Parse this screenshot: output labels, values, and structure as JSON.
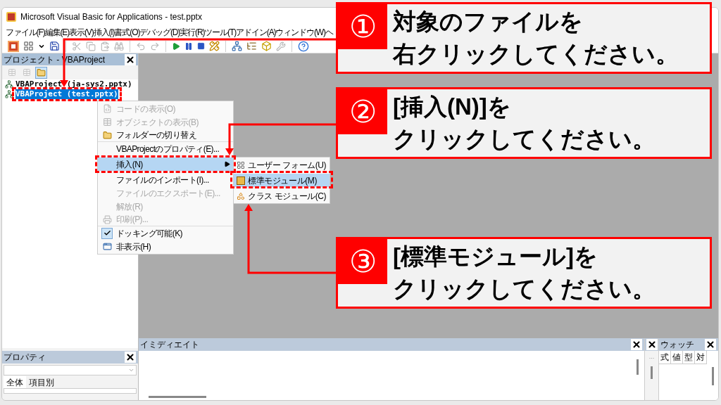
{
  "window": {
    "title": "Microsoft Visual Basic for Applications - test.pptx"
  },
  "menu_bar": [
    "ファイル(F)",
    "編集(E)",
    "表示(V)",
    "挿入(I)",
    "書式(O)",
    "デバッグ(D)",
    "実行(R)",
    "ツール(T)",
    "アドイン(A)",
    "ウィンドウ(W)",
    "ヘ"
  ],
  "toolbar": [
    {
      "kind": "app",
      "disabled": false
    },
    {
      "kind": "form",
      "disabled": false
    },
    {
      "kind": "caret",
      "disabled": false
    },
    {
      "kind": "save",
      "disabled": false
    },
    {
      "kind": "sep"
    },
    {
      "kind": "cut",
      "disabled": true
    },
    {
      "kind": "copy",
      "disabled": true
    },
    {
      "kind": "paste",
      "disabled": true
    },
    {
      "kind": "find",
      "disabled": true
    },
    {
      "kind": "sep"
    },
    {
      "kind": "undo",
      "disabled": true
    },
    {
      "kind": "redo",
      "disabled": true
    },
    {
      "kind": "sep"
    },
    {
      "kind": "run",
      "disabled": false
    },
    {
      "kind": "pause",
      "disabled": false
    },
    {
      "kind": "stop",
      "disabled": false
    },
    {
      "kind": "design",
      "disabled": false
    },
    {
      "kind": "sep"
    },
    {
      "kind": "explorer",
      "disabled": false
    },
    {
      "kind": "properties",
      "disabled": false
    },
    {
      "kind": "browser",
      "disabled": false
    },
    {
      "kind": "toolbox",
      "disabled": true
    },
    {
      "kind": "sep"
    },
    {
      "kind": "help",
      "disabled": false
    }
  ],
  "project_panel": {
    "title": "プロジェクト - VBAProject",
    "buttons": [
      {
        "kind": "code",
        "selected": false
      },
      {
        "kind": "object",
        "selected": false
      },
      {
        "kind": "folder",
        "selected": true
      }
    ],
    "tree": [
      {
        "label": "VBAProject (ja-sys2.pptx)",
        "selected": false
      },
      {
        "label": "VBAProject (test.pptx)",
        "selected": true
      }
    ]
  },
  "context_menu": [
    {
      "label": "コードの表示(O)",
      "kind": "code",
      "disabled": true,
      "selected": false,
      "checked": false,
      "separator_after": false
    },
    {
      "label": "オブジェクトの表示(B)",
      "kind": "object",
      "disabled": true,
      "selected": false,
      "checked": false,
      "separator_after": false
    },
    {
      "label": "フォルダーの切り替え",
      "kind": "folder",
      "disabled": false,
      "selected": false,
      "checked": false,
      "separator_after": true
    },
    {
      "label": "VBAProjectのプロパティ(E)...",
      "kind": "plain",
      "disabled": false,
      "selected": false,
      "checked": false,
      "separator_after": false
    },
    {
      "label": "挿入(N)",
      "kind": "submenu",
      "disabled": false,
      "selected": true,
      "checked": false,
      "separator_after": false
    },
    {
      "label": "ファイルのインポート(I)...",
      "kind": "plain",
      "disabled": false,
      "selected": false,
      "checked": false,
      "separator_after": false
    },
    {
      "label": "ファイルのエクスポート(E)...",
      "kind": "plain",
      "disabled": true,
      "selected": false,
      "checked": false,
      "separator_after": false
    },
    {
      "label": "解放(R)",
      "kind": "plain",
      "disabled": true,
      "selected": false,
      "checked": false,
      "separator_after": false
    },
    {
      "label": "印刷(P)...",
      "kind": "print",
      "disabled": true,
      "selected": false,
      "checked": false,
      "separator_after": true
    },
    {
      "label": "ドッキング可能(K)",
      "kind": "plain",
      "disabled": false,
      "selected": false,
      "checked": true,
      "separator_after": false
    },
    {
      "label": "非表示(H)",
      "kind": "window",
      "disabled": false,
      "selected": false,
      "checked": false,
      "separator_after": false
    }
  ],
  "submenu": [
    {
      "label": "ユーザー フォーム(U)",
      "kind": "form",
      "selected": false
    },
    {
      "label": "標準モジュール(M)",
      "kind": "module",
      "selected": true
    },
    {
      "label": "クラス モジュール(C)",
      "kind": "class",
      "selected": false
    }
  ],
  "properties_panel": {
    "title": "プロパティ",
    "tabs": [
      {
        "label": "全体",
        "selected": true
      },
      {
        "label": "項目別",
        "selected": false
      }
    ]
  },
  "immediate_panel": {
    "title": "イミディエイト"
  },
  "middle_panel": {
    "label": "..."
  },
  "watch_panel": {
    "title": "ウォッチ",
    "columns": [
      "式",
      "値",
      "型",
      "対"
    ]
  },
  "callouts": [
    {
      "number": "①",
      "lines": [
        "対象のファイルを",
        "右クリックしてください。"
      ]
    },
    {
      "number": "②",
      "lines": [
        "[挿入(N)]を",
        "クリックしてください。"
      ]
    },
    {
      "number": "③",
      "lines": [
        "[標準モジュール]を",
        "クリックしてください。"
      ]
    }
  ]
}
